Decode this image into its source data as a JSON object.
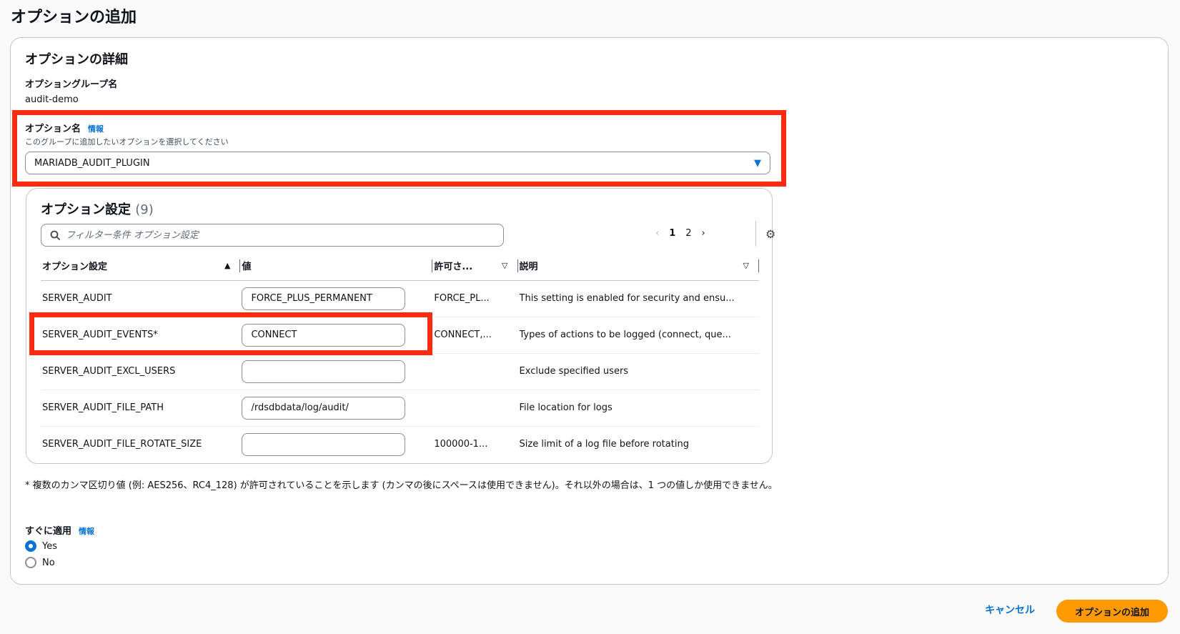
{
  "page": {
    "title": "オプションの追加"
  },
  "details": {
    "title": "オプションの詳細",
    "group_name_label": "オプショングループ名",
    "group_name_value": "audit-demo",
    "option_name_label": "オプション名",
    "info_link": "情報",
    "option_name_hint": "このグループに追加したいオプションを選択してください",
    "option_name_value": "MARIADB_AUDIT_PLUGIN"
  },
  "settings": {
    "title": "オプション設定",
    "count": "(9)",
    "filter_placeholder": "フィルター条件 オプション設定",
    "pager": {
      "page1": "1",
      "page2": "2"
    },
    "columns": {
      "name": "オプション設定",
      "value": "値",
      "allowed": "許可さ...",
      "description": "説明"
    },
    "rows": [
      {
        "name": "SERVER_AUDIT",
        "value": "FORCE_PLUS_PERMANENT",
        "allowed": "FORCE_PL...",
        "description": "This setting is enabled for security and ensu..."
      },
      {
        "name": "SERVER_AUDIT_EVENTS*",
        "value": "CONNECT",
        "allowed": "CONNECT,...",
        "description": "Types of actions to be logged (connect, que..."
      },
      {
        "name": "SERVER_AUDIT_EXCL_USERS",
        "value": "",
        "allowed": "",
        "description": "Exclude specified users"
      },
      {
        "name": "SERVER_AUDIT_FILE_PATH",
        "value": "/rdsdbdata/log/audit/",
        "allowed": "",
        "description": "File location for logs"
      },
      {
        "name": "SERVER_AUDIT_FILE_ROTATE_SIZE",
        "value": "",
        "allowed": "100000-1...",
        "description": "Size limit of a log file before rotating"
      }
    ]
  },
  "footnote": "* 複数のカンマ区切り値 (例: AES256、RC4_128) が許可されていることを示します (カンマの後にスペースは使用できません)。それ以外の場合は、1 つの値しか使用できません。",
  "apply": {
    "label": "すぐに適用",
    "info_link": "情報",
    "options": [
      "Yes",
      "No"
    ],
    "selected": "Yes"
  },
  "actions": {
    "cancel": "キャンセル",
    "submit": "オプションの追加"
  },
  "colors": {
    "accent": "#0972d3",
    "primary_button": "#ff9900",
    "highlight": "#ff2a12"
  }
}
